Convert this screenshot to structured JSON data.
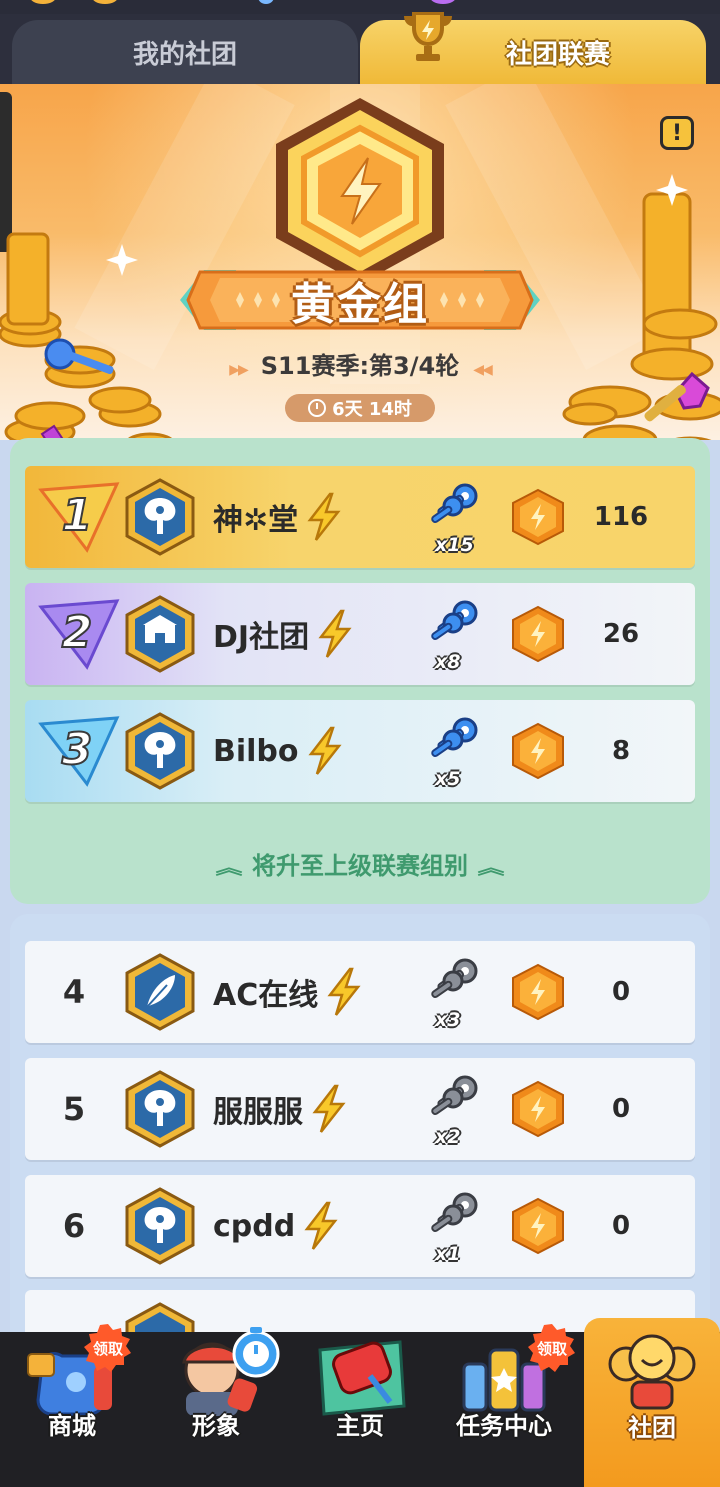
{
  "tabs": {
    "my_club": "我的社团",
    "club_league": "社团联赛"
  },
  "banner": {
    "tier_name": "黄金组",
    "season": "S11赛季:第3/4轮",
    "timer": "6天 14时",
    "info_glyph": "!"
  },
  "promotion_rows": [
    {
      "rank": "1",
      "name": "神✲堂",
      "keys": "x15",
      "score": "116",
      "badge": "tree-emblem",
      "key_color": "blue"
    },
    {
      "rank": "2",
      "name": "DJ社团",
      "keys": "x8",
      "score": "26",
      "badge": "castle-emblem",
      "key_color": "blue"
    },
    {
      "rank": "3",
      "name": "Bilbo",
      "keys": "x5",
      "score": "8",
      "badge": "tree-emblem",
      "key_color": "blue"
    }
  ],
  "promote_text": "将升至上级联赛组别",
  "normal_rows": [
    {
      "rank": "4",
      "name": "AC在线",
      "keys": "x3",
      "score": "0",
      "badge": "feather-emblem",
      "key_color": "gray"
    },
    {
      "rank": "5",
      "name": "服服服",
      "keys": "x2",
      "score": "0",
      "badge": "tree-emblem",
      "key_color": "gray"
    },
    {
      "rank": "6",
      "name": "cpdd",
      "keys": "x1",
      "score": "0",
      "badge": "tree-emblem",
      "key_color": "gray"
    }
  ],
  "nav": {
    "shop": "商城",
    "avatar": "形象",
    "home": "主页",
    "tasks": "任务中心",
    "club": "社团",
    "claim_badge": "领取"
  },
  "colors": {
    "gold": "#f7d46c",
    "accent_orange": "#f39a1e",
    "promo_green": "#3f9a6e",
    "nav_bg": "#202024"
  }
}
